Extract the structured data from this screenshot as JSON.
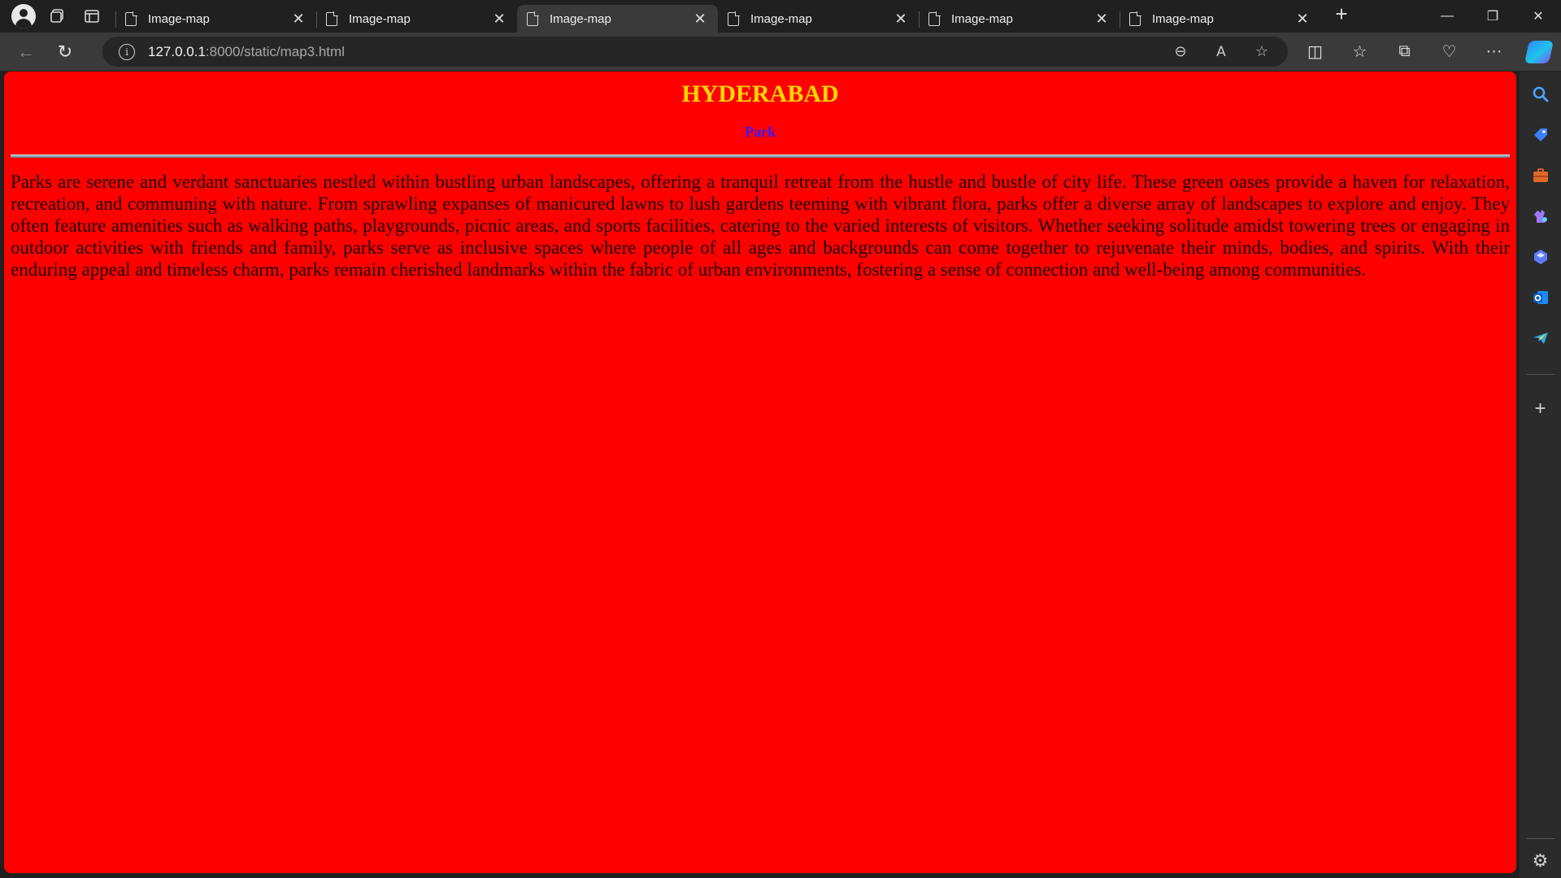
{
  "browser": {
    "tabs": [
      {
        "title": "Image-map",
        "active": false
      },
      {
        "title": "Image-map",
        "active": false
      },
      {
        "title": "Image-map",
        "active": true
      },
      {
        "title": "Image-map",
        "active": false
      },
      {
        "title": "Image-map",
        "active": false
      },
      {
        "title": "Image-map",
        "active": false
      }
    ],
    "address": {
      "host": "127.0.0.1",
      "path": ":8000/static/map3.html"
    }
  },
  "page": {
    "background": "#ff0000",
    "title": "HYDERABAD",
    "title_color": "#ffd700",
    "subtitle": "Park",
    "subtitle_color": "#3a1bff",
    "body": "Parks are serene and verdant sanctuaries nestled within bustling urban landscapes, offering a tranquil retreat from the hustle and bustle of city life. These green oases provide a haven for relaxation, recreation, and communing with nature. From sprawling expanses of manicured lawns to lush gardens teeming with vibrant flora, parks offer a diverse array of landscapes to explore and enjoy. They often feature amenities such as walking paths, playgrounds, picnic areas, and sports facilities, catering to the varied interests of visitors. Whether seeking solitude amidst towering trees or engaging in outdoor activities with friends and family, parks serve as inclusive spaces where people of all ages and backgrounds can come together to rejuvenate their minds, bodies, and spirits. With their enduring appeal and timeless charm, parks remain cherished landmarks within the fabric of urban environments, fostering a sense of connection and well-being among communities."
  },
  "sidebar": {
    "items": [
      {
        "icon": "search-icon",
        "color": "#4aa3ff"
      },
      {
        "icon": "shopping-tag-icon",
        "color": "#3d7eff"
      },
      {
        "icon": "tools-briefcase-icon",
        "color": "#e0682a"
      },
      {
        "icon": "games-icon",
        "color": "#9b7bff"
      },
      {
        "icon": "copilot-app-icon",
        "color": "#5d7bff"
      },
      {
        "icon": "outlook-icon",
        "color": "#1a8cff"
      },
      {
        "icon": "telegram-icon",
        "color": "#2fa8e8"
      }
    ]
  }
}
